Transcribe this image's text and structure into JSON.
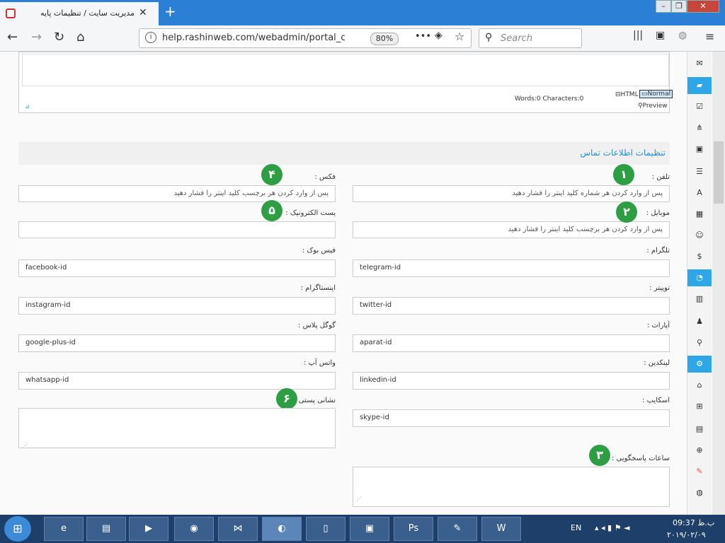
{
  "browser": {
    "tab_title": "مدیریت سایت / تنظیمات پایه",
    "url": "help.rashinweb.com/webadmin/portal_con",
    "zoom": "80%",
    "search_placeholder": "Search"
  },
  "editor": {
    "mode_html": "HTML",
    "mode_normal": "Normal",
    "preview": "Preview",
    "counts": "Words:0 Characters:0"
  },
  "section": {
    "title": "تنظیمات اطلاعات تماس"
  },
  "fields": {
    "phone": {
      "label": "تلفن :",
      "placeholder": "پس از وارد کردن هر شماره کلید اینتر را فشار دهید",
      "badge": "١"
    },
    "mobile": {
      "label": "موبایل :",
      "placeholder": "پس از وارد کردن هر برچسب کلید اینتر را فشار دهید",
      "badge": "٢"
    },
    "hours": {
      "label": "ساعات پاسخگویی :",
      "badge": "٣"
    },
    "fax": {
      "label": "فکس :",
      "placeholder": "پس از وارد کردن هر برچسب کلید اینتر را فشار دهید",
      "badge": "۴"
    },
    "email": {
      "label": "پست الکترونیک :",
      "badge": "۵"
    },
    "address": {
      "label": "نشانی پستی :",
      "badge": "۶"
    },
    "facebook": {
      "label": "فیس بوک :",
      "value": "facebook-id"
    },
    "telegram": {
      "label": "تلگرام :",
      "value": "telegram-id"
    },
    "instagram": {
      "label": "اینستاگرام :",
      "value": "instagram-id"
    },
    "twitter": {
      "label": "توییتر :",
      "value": "twitter-id"
    },
    "googleplus": {
      "label": "گوگل پلاس :",
      "value": "google-plus-id"
    },
    "aparat": {
      "label": "آپارات :",
      "value": "aparat-id"
    },
    "whatsapp": {
      "label": "واتس آپ :",
      "value": "whatsapp-id"
    },
    "linkedin": {
      "label": "لینکدین :",
      "value": "linkedin-id"
    },
    "skype": {
      "label": "اسکایپ :",
      "value": "skype-id"
    }
  },
  "taskbar": {
    "lang": "EN",
    "time": "09:37 ب.ظ",
    "date": "۲۰۱۹/۰۲/۰۹"
  },
  "colors": {
    "accent": "#2ea7e8",
    "badge": "#2e9e44",
    "tabbar": "#2b7fd4"
  }
}
